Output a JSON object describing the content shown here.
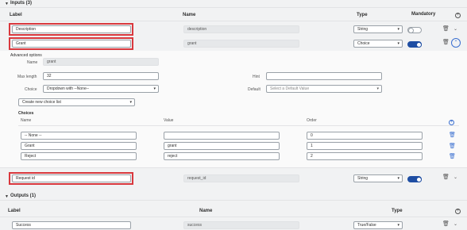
{
  "inputs_section": {
    "title": "Inputs (3)"
  },
  "outputs_section": {
    "title": "Outputs (1)"
  },
  "columns": {
    "label": "Label",
    "name": "Name",
    "type": "Type",
    "mandatory": "Mandatory"
  },
  "input_rows": [
    {
      "label": "Description",
      "name": "description",
      "type": "String",
      "mandatory": false
    },
    {
      "label": "Grant",
      "name": "grant",
      "type": "Choice",
      "mandatory": true
    },
    {
      "label": "Request id",
      "name": "request_id",
      "type": "String",
      "mandatory": true
    }
  ],
  "advanced": {
    "title": "Advanced options",
    "name_label": "Name",
    "name_value": "grant",
    "max_length_label": "Max length",
    "max_length_value": "32",
    "hint_label": "Hint",
    "hint_value": "",
    "choice_label": "Choice",
    "choice_value": "Dropdown with --None--",
    "default_label": "Default",
    "default_placeholder": "Select a Default Value",
    "choice_list_value": "Create new choice list"
  },
  "choices": {
    "title": "Choices",
    "col_name": "Name",
    "col_value": "Value",
    "col_order": "Order",
    "rows": [
      {
        "name": "-- None --",
        "value": "",
        "order": "0"
      },
      {
        "name": "Grant",
        "value": "grant",
        "order": "1"
      },
      {
        "name": "Reject",
        "value": "reject",
        "order": "2"
      }
    ]
  },
  "output_rows": [
    {
      "label": "Success",
      "name": "success",
      "type": "True/False"
    }
  ],
  "colors": {
    "accent": "#1f4ea3",
    "highlight": "#d9383d"
  },
  "icons": {
    "trash": "trash-icon",
    "chevron": "chevron-down-icon",
    "add": "plus-circle-icon"
  }
}
